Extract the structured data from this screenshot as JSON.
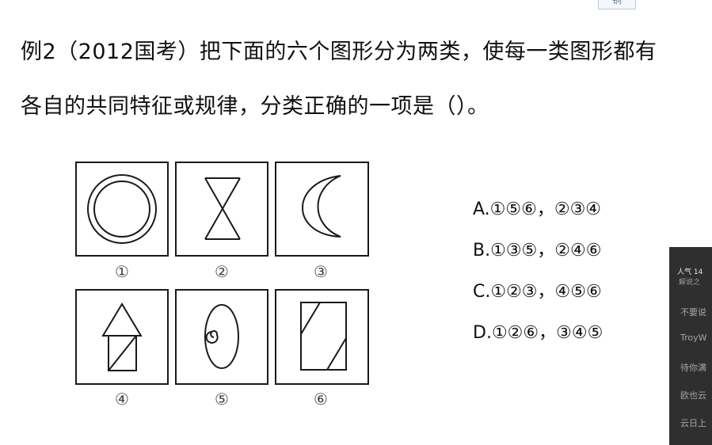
{
  "question": {
    "line1": "例2（2012国考）把下面的六个图形分为两类，使每一类图形都有",
    "line2": "各自的共同特征或规律，分类正确的一项是（）。"
  },
  "top_tag": "铜 ",
  "figures": [
    {
      "label": "①",
      "shape": "double-circle"
    },
    {
      "label": "②",
      "shape": "hourglass"
    },
    {
      "label": "③",
      "shape": "crescent"
    },
    {
      "label": "④",
      "shape": "triangle-on-square"
    },
    {
      "label": "⑤",
      "shape": "ellipse-with-spiral"
    },
    {
      "label": "⑥",
      "shape": "rectangle-with-diagonals"
    }
  ],
  "options": [
    {
      "letter": "A.",
      "group1": "①⑤⑥",
      "sep": "，",
      "group2": "②③④"
    },
    {
      "letter": "B.",
      "group1": "①③⑤",
      "sep": "，",
      "group2": "②④⑥"
    },
    {
      "letter": "C.",
      "group1": "①②③",
      "sep": "，",
      "group2": "④⑤⑥"
    },
    {
      "letter": "D.",
      "group1": "①②⑥",
      "sep": "，",
      "group2": "③④⑤"
    }
  ],
  "live_panel": {
    "viewer_count": "人气 14",
    "viewer_sub": "解说之",
    "chat": [
      "不要说",
      "TroyW",
      "待你满",
      "欧也云",
      "云日上"
    ]
  },
  "colors": {
    "stroke": "#1a1a1a",
    "label": "#444444",
    "panel_bg": "#2f2f2f"
  }
}
